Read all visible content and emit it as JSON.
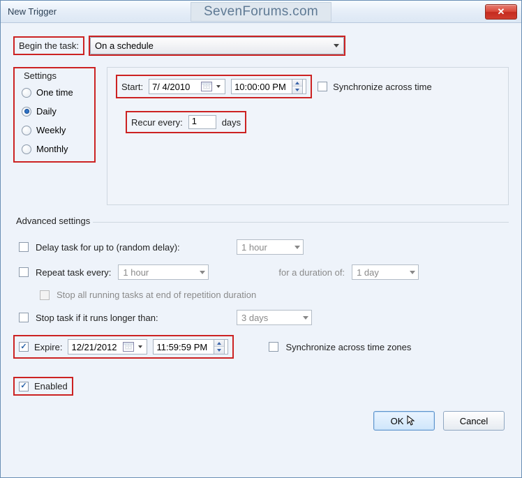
{
  "window": {
    "title": "New Trigger",
    "watermark": "SevenForums.com"
  },
  "begin": {
    "label": "Begin the task:",
    "value": "On a schedule"
  },
  "schedule": {
    "group_label": "Settings",
    "options": {
      "one_time": "One time",
      "daily": "Daily",
      "weekly": "Weekly",
      "monthly": "Monthly"
    },
    "selected": "daily"
  },
  "start": {
    "label": "Start:",
    "date": "7/ 4/2010",
    "time": "10:00:00 PM",
    "sync_label": "Synchronize across time"
  },
  "recur": {
    "label": "Recur every:",
    "value": "1",
    "unit": "days"
  },
  "advanced": {
    "title": "Advanced settings",
    "delay": {
      "label": "Delay task for up to (random delay):",
      "value": "1 hour"
    },
    "repeat": {
      "label": "Repeat task every:",
      "value": "1 hour",
      "duration_label": "for a duration of:",
      "duration_value": "1 day"
    },
    "stop_all": {
      "label": "Stop all running tasks at end of repetition duration"
    },
    "stop_if": {
      "label": "Stop task if it runs longer than:",
      "value": "3 days"
    },
    "expire": {
      "label": "Expire:",
      "date": "12/21/2012",
      "time": "11:59:59 PM",
      "sync_label": "Synchronize across time zones"
    },
    "enabled": {
      "label": "Enabled"
    }
  },
  "buttons": {
    "ok": "OK",
    "cancel": "Cancel"
  }
}
